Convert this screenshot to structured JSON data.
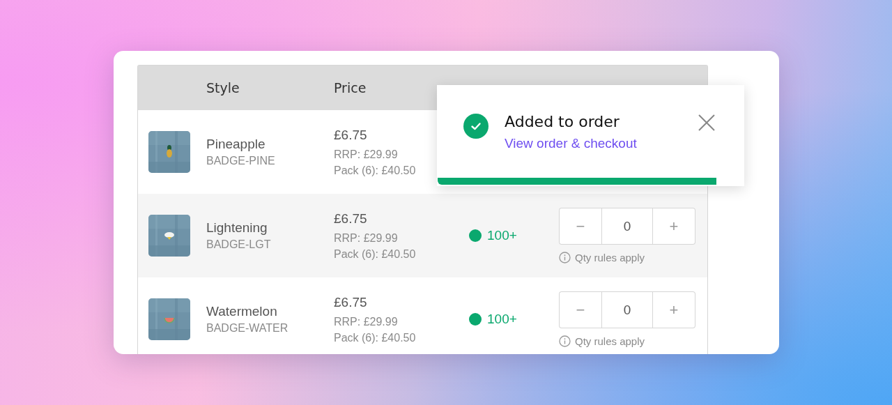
{
  "table": {
    "columns": [
      "Style",
      "Price"
    ],
    "rows": [
      {
        "name": "Pineapple",
        "sku": "BADGE-PINE",
        "price": "£6.75",
        "rrp": "RRP: £29.99",
        "pack": "Pack (6): £40.50"
      },
      {
        "name": "Lightening",
        "sku": "BADGE-LGT",
        "price": "£6.75",
        "rrp": "RRP: £29.99",
        "pack": "Pack (6): £40.50",
        "stock": "100+",
        "qty": {
          "value": "0",
          "minus": "−",
          "plus": "+",
          "note": "Qty rules apply"
        }
      },
      {
        "name": "Watermelon",
        "sku": "BADGE-WATER",
        "price": "£6.75",
        "rrp": "RRP: £29.99",
        "pack": "Pack (6): £40.50",
        "stock": "100+",
        "qty": {
          "value": "0",
          "minus": "−",
          "plus": "+",
          "note": "Qty rules apply"
        }
      }
    ]
  },
  "toast": {
    "title": "Added to order",
    "link": "View order & checkout",
    "level": 0.91
  }
}
